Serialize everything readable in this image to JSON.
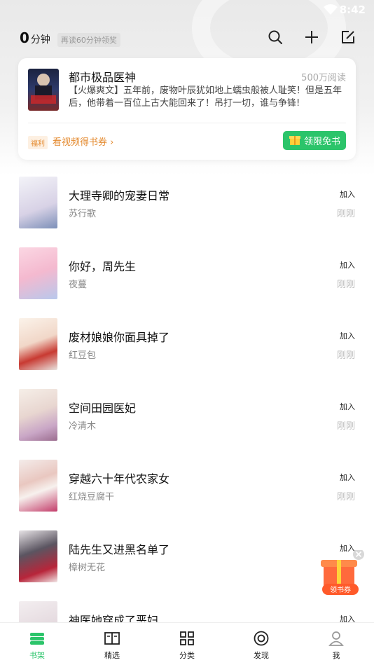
{
  "status_bar": {
    "time": "8:42"
  },
  "header": {
    "reading_minutes": "0",
    "reading_unit": "分钟",
    "reading_hint": "再读60分钟领奖",
    "icons": [
      "search-icon",
      "plus-icon",
      "edit-icon"
    ]
  },
  "featured": {
    "title": "都市极品医神",
    "reads": "500万阅读",
    "description": "【火爆爽文】五年前，废物叶辰犹如地上蠕虫般被人耻笑！但是五年后，他带着一百位上古大能回来了！吊打一切，谁与争锋!",
    "welfare_badge": "福利",
    "welfare_link": "看视频得书券",
    "free_button": "领限免书",
    "accent": "#2bc46a"
  },
  "books": [
    {
      "title": "大理寺卿的宠妻日常",
      "author": "苏行歌",
      "add": "加入",
      "time": "刚刚"
    },
    {
      "title": "你好，周先生",
      "author": "夜蔓",
      "add": "加入",
      "time": "刚刚"
    },
    {
      "title": "废材娘娘你面具掉了",
      "author": "红豆包",
      "add": "加入",
      "time": "刚刚"
    },
    {
      "title": "空间田园医妃",
      "author": "冷清木",
      "add": "加入",
      "time": "刚刚"
    },
    {
      "title": "穿越六十年代农家女",
      "author": "红烧豆腐干",
      "add": "加入",
      "time": "刚刚"
    },
    {
      "title": "陆先生又进黑名单了",
      "author": "樟树无花",
      "add": "加入",
      "time": ""
    },
    {
      "title": "神医她穿成了恶妇",
      "author": "",
      "add": "加入",
      "time": ""
    }
  ],
  "gift": {
    "label": "领书券"
  },
  "tabs": [
    {
      "label": "书架",
      "icon": "bookshelf-icon",
      "active": true
    },
    {
      "label": "精选",
      "icon": "open-book-icon",
      "active": false
    },
    {
      "label": "分类",
      "icon": "grid-icon",
      "active": false
    },
    {
      "label": "发现",
      "icon": "discover-icon",
      "active": false
    },
    {
      "label": "我",
      "icon": "profile-icon",
      "active": false
    }
  ]
}
